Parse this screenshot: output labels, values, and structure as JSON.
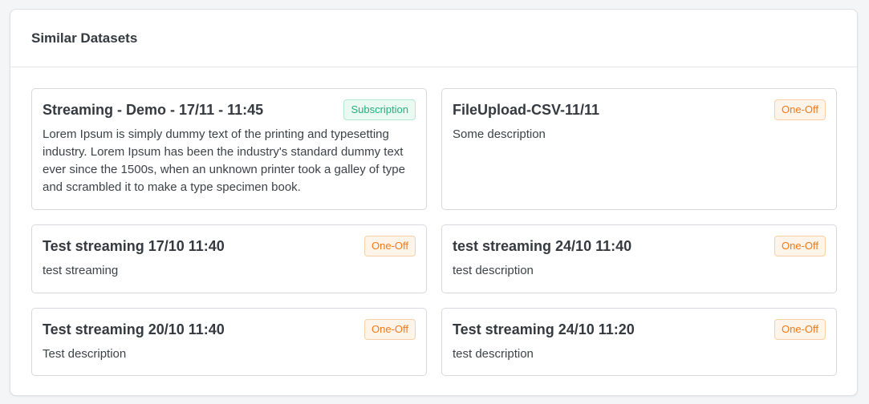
{
  "panel": {
    "title": "Similar Datasets"
  },
  "datasets": [
    {
      "title": "Streaming - Demo - 17/11 - 11:45",
      "badge": "Subscription",
      "description": "Lorem Ipsum is simply dummy text of the printing and typesetting industry. Lorem Ipsum has been the industry's standard dummy text ever since the 1500s, when an unknown printer took a galley of type and scrambled it to make a type specimen book."
    },
    {
      "title": "FileUpload-CSV-11/11",
      "badge": "One-Off",
      "description": "Some description"
    },
    {
      "title": "Test streaming 17/10 11:40",
      "badge": "One-Off",
      "description": "test streaming"
    },
    {
      "title": "test streaming 24/10 11:40",
      "badge": "One-Off",
      "description": "test description"
    },
    {
      "title": "Test streaming 20/10 11:40",
      "badge": "One-Off",
      "description": "Test description"
    },
    {
      "title": "Test streaming 24/10 11:20",
      "badge": "One-Off",
      "description": "test description"
    }
  ],
  "colors": {
    "subscription": "#22b07d",
    "one_off": "#f07a1a"
  }
}
